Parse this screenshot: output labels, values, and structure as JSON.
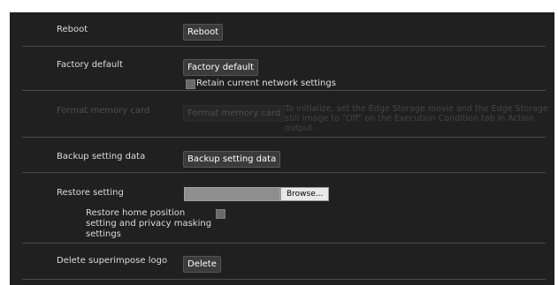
{
  "rows": {
    "reboot": {
      "label": "Reboot",
      "button": "Reboot"
    },
    "factory_default": {
      "label": "Factory default",
      "button": "Factory default",
      "checkbox_label": "Retain current network settings"
    },
    "format_memory_card": {
      "label": "Format memory card",
      "button": "Format memory card",
      "note": "To initialize, set the Edge Storage movie and the Edge Storage still image to \"Off\" on the Execution Condition tab in Action output."
    },
    "backup": {
      "label": "Backup setting data",
      "button": "Backup setting data"
    },
    "restore": {
      "label": "Restore setting",
      "browse_button": "Browse...",
      "option_label": "Restore home position setting and privacy masking settings"
    },
    "delete_logo": {
      "label": "Delete superimpose logo",
      "button": "Delete"
    }
  }
}
